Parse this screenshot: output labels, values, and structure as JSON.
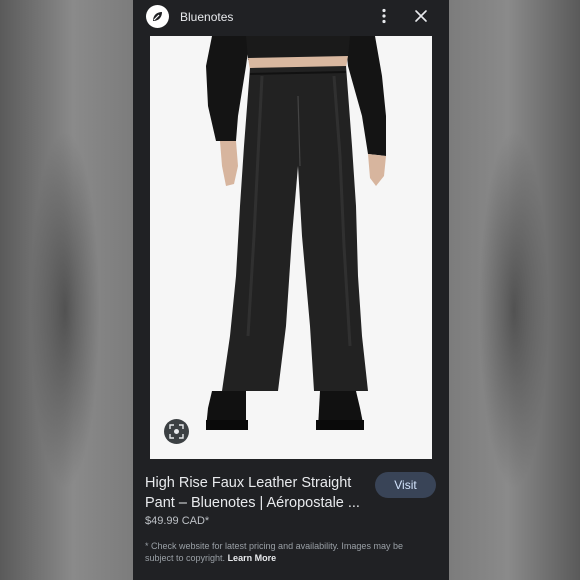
{
  "app": {
    "site_name": "Bluenotes",
    "logo_icon": "bluenotes-logo-icon"
  },
  "toolbar": {
    "more_icon": "more-vert-icon",
    "close_icon": "close-icon"
  },
  "image": {
    "description_icon": "pants-photo",
    "lens_icon": "lens-icon"
  },
  "product": {
    "title": "High Rise Faux Leather Straight Pant – Bluenotes | Aéropostale ...",
    "price": "$49.99 CAD*",
    "visit_label": "Visit"
  },
  "footer": {
    "disclaimer": "* Check website for latest pricing and availability. Images may be subject to copyright.",
    "learn_more": "Learn More"
  },
  "colors": {
    "panel": "#202124",
    "visit_bg": "#394457",
    "visit_text": "#d2e3fc"
  }
}
